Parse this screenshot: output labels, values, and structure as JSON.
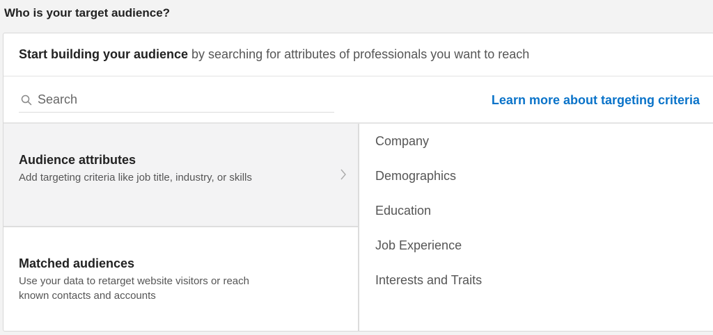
{
  "page": {
    "heading": "Who is your target audience?"
  },
  "intro": {
    "bold": "Start building your audience",
    "rest": " by searching for attributes of professionals you want to reach"
  },
  "search": {
    "placeholder": "Search",
    "icon": "search-icon"
  },
  "learn_more": "Learn more about targeting criteria",
  "options": [
    {
      "title": "Audience attributes",
      "description": "Add targeting criteria like job title, industry, or skills",
      "selected": true
    },
    {
      "title": "Matched audiences",
      "description": "Use your data to retarget website visitors or reach known contacts and accounts",
      "selected": false
    }
  ],
  "attributes": [
    "Company",
    "Demographics",
    "Education",
    "Job Experience",
    "Interests and Traits"
  ],
  "colors": {
    "link": "#0a73c9",
    "selected_bg": "#f3f3f4",
    "page_bg": "#f3f3f3"
  }
}
